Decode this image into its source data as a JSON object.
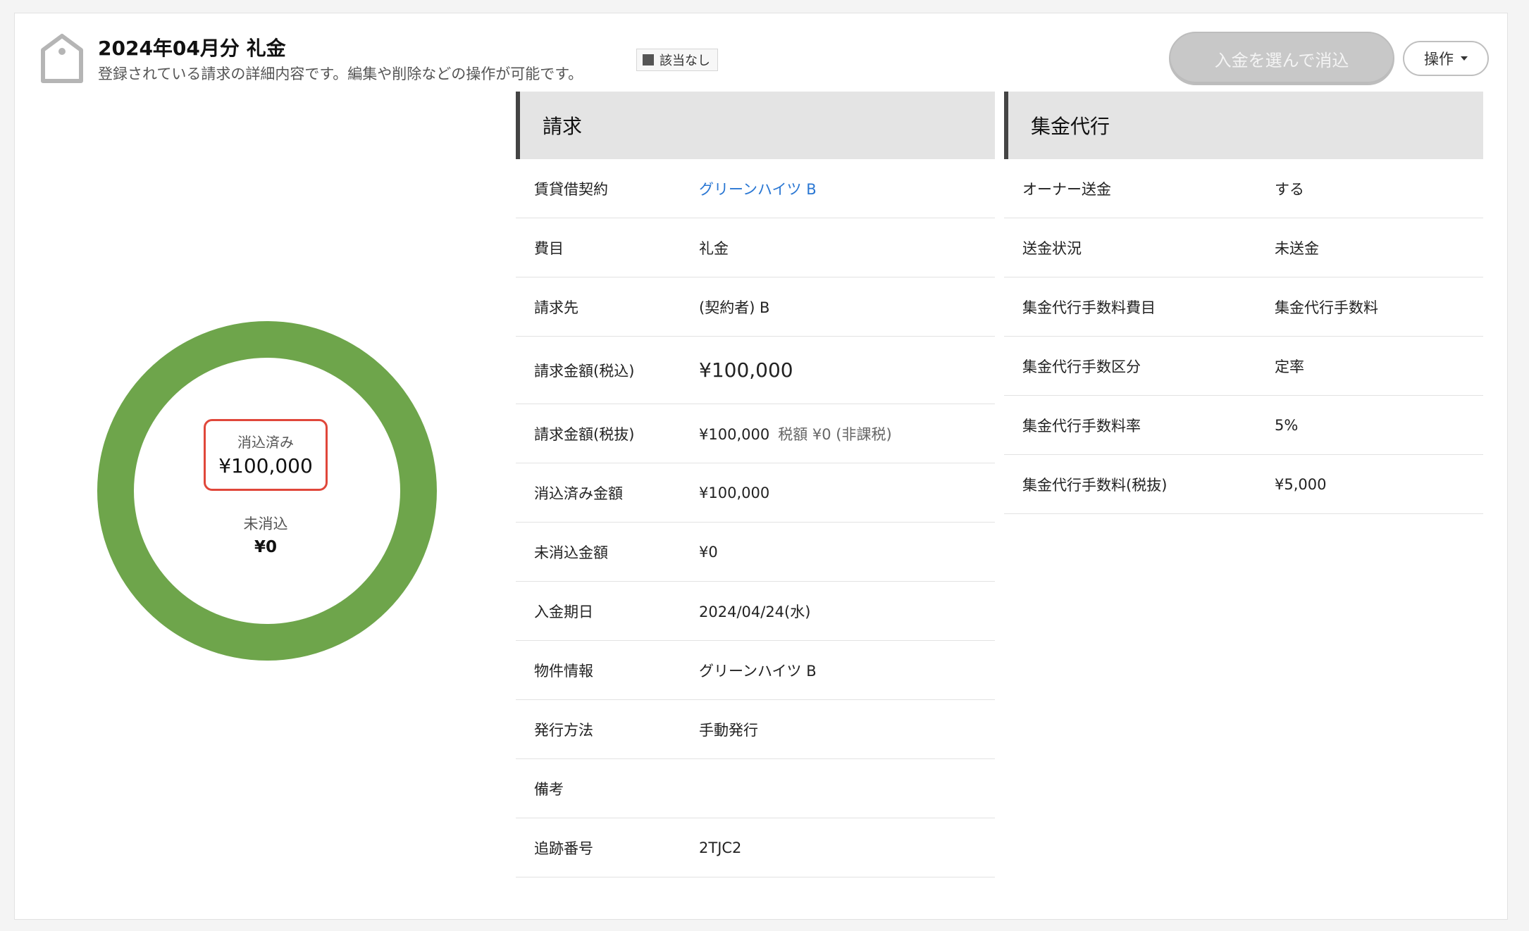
{
  "header": {
    "title": "2024年04月分 礼金",
    "subtitle": "登録されている請求の詳細内容です。編集や削除などの操作が可能です。",
    "badge": "該当なし",
    "reconcile_button": "入金を選んで消込",
    "operations_button": "操作"
  },
  "summary": {
    "reconciled_label": "消込済み",
    "reconciled_amount": "¥100,000",
    "unreconciled_label": "未消込",
    "unreconciled_amount": "¥0",
    "reconciled_fraction": 1.0,
    "donut_color": "#6ea54b",
    "highlight_color": "#e0473a"
  },
  "billing": {
    "heading": "請求",
    "rows": [
      {
        "label": "賃貸借契約",
        "value": "グリーンハイツ B"
      },
      {
        "label": "費目",
        "value": "礼金"
      },
      {
        "label": "請求先",
        "value": "(契約者) B"
      },
      {
        "label": "請求金額(税込)",
        "value": "¥100,000"
      },
      {
        "label": "請求金額(税抜)",
        "value": "¥100,000",
        "tax_note": "税額 ¥0 (非課税)"
      },
      {
        "label": "消込済み金額",
        "value": "¥100,000"
      },
      {
        "label": "未消込金額",
        "value": "¥0"
      },
      {
        "label": "入金期日",
        "value": "2024/04/24(水)"
      },
      {
        "label": "物件情報",
        "value": "グリーンハイツ B"
      },
      {
        "label": "発行方法",
        "value": "手動発行"
      },
      {
        "label": "備考",
        "value": ""
      },
      {
        "label": "追跡番号",
        "value": "2TJC2"
      }
    ]
  },
  "collection": {
    "heading": "集金代行",
    "rows": [
      {
        "label": "オーナー送金",
        "value": "する"
      },
      {
        "label": "送金状況",
        "value": "未送金"
      },
      {
        "label": "集金代行手数料費目",
        "value": "集金代行手数料"
      },
      {
        "label": "集金代行手数区分",
        "value": "定率"
      },
      {
        "label": "集金代行手数料率",
        "value": "5%"
      },
      {
        "label": "集金代行手数料(税抜)",
        "value": "¥5,000"
      }
    ]
  }
}
